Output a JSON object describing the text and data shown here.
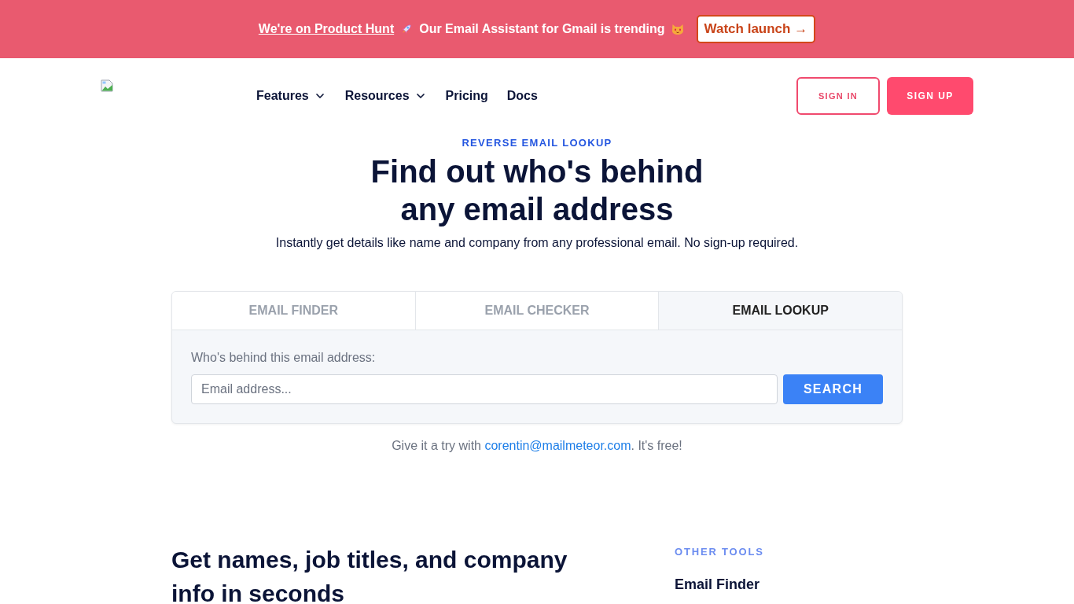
{
  "announcement_bar": {
    "link": "We're on Product Hunt",
    "message": "Our Email Assistant for Gmail is trending",
    "button": "Watch launch →"
  },
  "navbar": {
    "items": [
      {
        "label": "Features",
        "has_dropdown": true
      },
      {
        "label": "Resources",
        "has_dropdown": true
      },
      {
        "label": "Pricing",
        "has_dropdown": false
      },
      {
        "label": "Docs",
        "has_dropdown": false
      }
    ],
    "sign_in": "SIGN IN",
    "sign_up": "SIGN UP"
  },
  "hero": {
    "eyebrow": "REVERSE EMAIL LOOKUP",
    "title_lines": [
      "Find out who's behind",
      "any email address"
    ],
    "subtitle": "Instantly get details like name and company from any professional email. No sign-up required."
  },
  "tool_card": {
    "tabs": [
      {
        "label": "EMAIL FINDER",
        "selected": false
      },
      {
        "label": "EMAIL CHECKER",
        "selected": false
      },
      {
        "label": "EMAIL LOOKUP",
        "selected": true
      }
    ],
    "field_label": "Who's behind this email address:",
    "input": {
      "placeholder": "Email address..."
    },
    "button": "SEARCH"
  },
  "try_hint": {
    "before": "Give it a try with ",
    "link": "corentin@mailmeteor.com",
    "after": ". It's free!"
  },
  "features_section": {
    "heading": "Get names, job titles, and company info in seconds"
  },
  "other_tools": {
    "title": "OTHER TOOLS",
    "items": [
      "Email Finder"
    ]
  }
}
